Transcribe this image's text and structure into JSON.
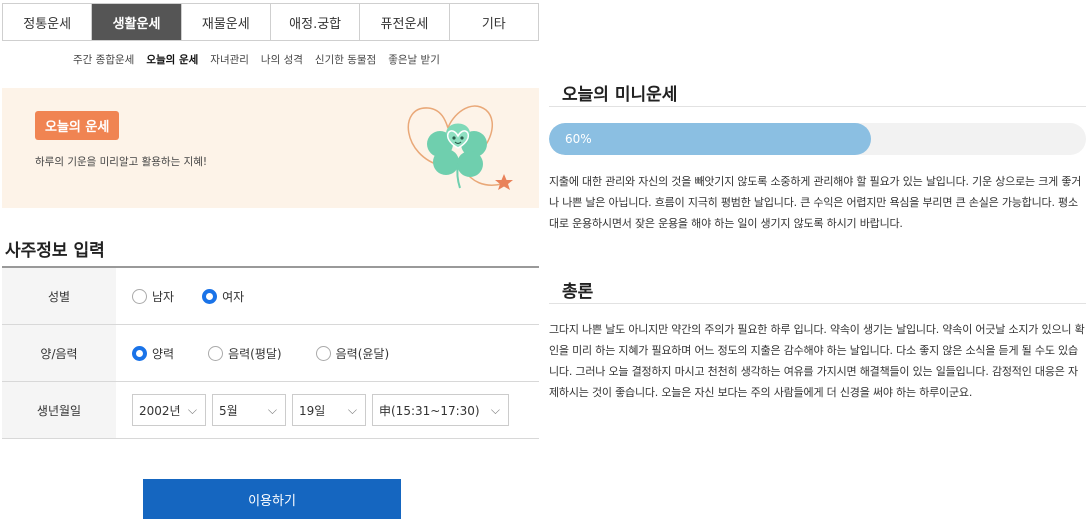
{
  "tabs": [
    {
      "label": "정통운세",
      "active": false
    },
    {
      "label": "생활운세",
      "active": true
    },
    {
      "label": "재물운세",
      "active": false
    },
    {
      "label": "애정.궁합",
      "active": false
    },
    {
      "label": "퓨전운세",
      "active": false
    },
    {
      "label": "기타",
      "active": false
    }
  ],
  "subnav": [
    {
      "label": "주간 종합운세",
      "active": false
    },
    {
      "label": "오늘의 운세",
      "active": true
    },
    {
      "label": "자녀관리",
      "active": false
    },
    {
      "label": "나의 성격",
      "active": false
    },
    {
      "label": "신기한 동물점",
      "active": false
    },
    {
      "label": "좋은날 받기",
      "active": false
    }
  ],
  "banner": {
    "badge": "오늘의 운세",
    "text": "하루의 기운을 미리알고 활용하는 지혜!"
  },
  "form": {
    "title": "사주정보 입력",
    "gender_label": "성별",
    "gender_options": [
      {
        "label": "남자",
        "checked": false
      },
      {
        "label": "여자",
        "checked": true
      }
    ],
    "calendar_label": "양/음력",
    "calendar_options": [
      {
        "label": "양력",
        "checked": true
      },
      {
        "label": "음력(평달)",
        "checked": false
      },
      {
        "label": "음력(윤달)",
        "checked": false
      }
    ],
    "birth_label": "생년월일",
    "year": "2002년",
    "month": "5월",
    "day": "19일",
    "hour": "申(15:31~17:30)",
    "submit": "이용하기"
  },
  "mini": {
    "title": "오늘의 미니운세",
    "progress_label": "60%",
    "progress_value": 0.6,
    "text": "지출에 대한 관리와 자신의 것을 빼앗기지 않도록 소중하게 관리해야 할 필요가 있는 날입니다. 기운 상으로는 크게 좋거나 나쁜 날은 아닙니다. 흐름이 지극히 평범한 날입니다. 큰 수익은 어렵지만 욕심을 부리면 큰 손실은 가능합니다. 평소대로 운용하시면서 잦은 운용을 해야 하는 일이 생기지 않도록 하시기 바랍니다."
  },
  "summary": {
    "title": "총론",
    "text": "그다지 나쁜 날도 아니지만 약간의 주의가 필요한 하루 입니다. 약속이 생기는 날입니다. 약속이 어긋날 소지가 있으니 확인을 미리 하는 지혜가 필요하며 어느 정도의 지출은 감수해야 하는 날입니다. 다소 좋지 않은 소식을 듣게 될 수도 있습니다. 그러나 오늘 결정하지 마시고 천천히 생각하는 여유를 가지시면 해결책들이 있는 일들입니다. 감정적인 대응은 자제하시는 것이 좋습니다. 오늘은 자신 보다는 주의 사람들에게 더 신경을 써야 하는 하루이군요."
  },
  "colors": {
    "accent": "#1566c0",
    "badge": "#f08452",
    "progress": "#8bbfe2",
    "banner_bg": "#fdf3e8"
  }
}
